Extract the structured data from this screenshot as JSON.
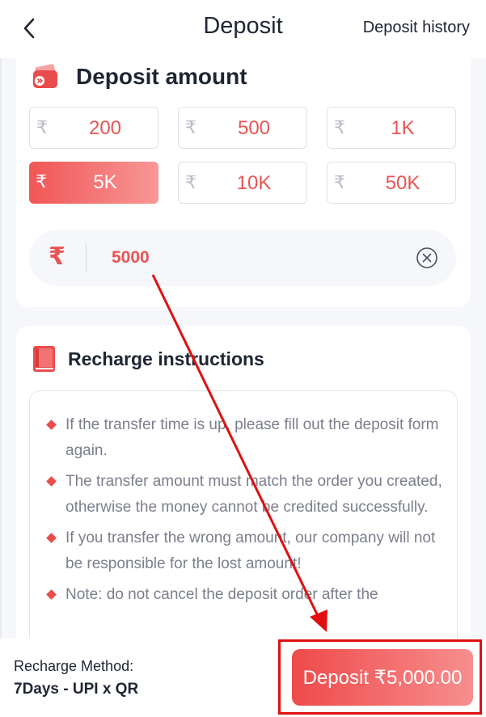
{
  "header": {
    "title": "Deposit",
    "history_link": "Deposit history"
  },
  "amount_section": {
    "title": "Deposit amount",
    "currency_symbol": "₹",
    "chips": [
      {
        "label": "200",
        "active": false
      },
      {
        "label": "500",
        "active": false
      },
      {
        "label": "1K",
        "active": false
      },
      {
        "label": "5K",
        "active": true
      },
      {
        "label": "10K",
        "active": false
      },
      {
        "label": "50K",
        "active": false
      }
    ],
    "input_value": "5000"
  },
  "instructions": {
    "title": "Recharge instructions",
    "items": [
      "If the transfer time is up, please fill out the deposit form again.",
      "The transfer amount must match the order you created, otherwise the money cannot be credited successfully.",
      "If you transfer the wrong amount, our company will not be responsible for the lost amount!",
      "Note: do not cancel the deposit order after the"
    ]
  },
  "footer": {
    "method_label": "Recharge Method:",
    "method_value": "7Days - UPI x QR",
    "deposit_button": "Deposit ₹5,000.00"
  },
  "colors": {
    "accent": "#e95454",
    "annotation": "#e01010"
  },
  "icons": {
    "back": "chevron-left-icon",
    "wallet": "wallet-icon",
    "book": "book-icon",
    "clear": "clear-circle-icon"
  }
}
